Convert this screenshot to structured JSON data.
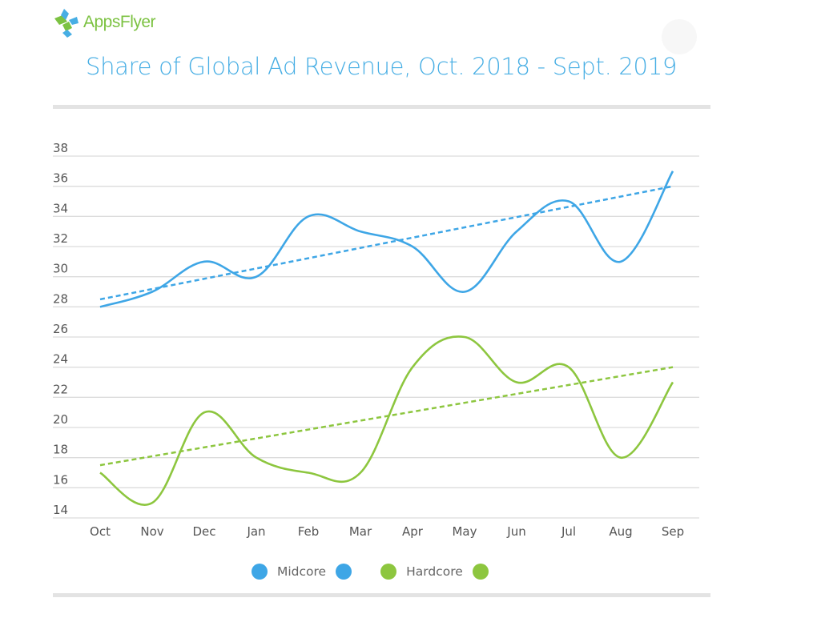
{
  "brand": {
    "name": "AppsFlyer",
    "logo_colors": [
      "#7cc242",
      "#47aee4"
    ]
  },
  "chart_data": {
    "type": "line",
    "title": "Share of Global Ad Revenue, Oct. 2018 - Sept. 2019",
    "xlabel": "",
    "ylabel": "",
    "categories": [
      "Oct",
      "Nov",
      "Dec",
      "Jan",
      "Feb",
      "Mar",
      "Apr",
      "May",
      "Jun",
      "Jul",
      "Aug",
      "Sep"
    ],
    "yticks": [
      14,
      16,
      18,
      20,
      22,
      24,
      26,
      28,
      30,
      32,
      34,
      36,
      38
    ],
    "ylim": [
      14,
      38
    ],
    "grid": true,
    "legend_position": "bottom-center",
    "series": [
      {
        "name": "Midcore",
        "color": "#3ea6e6",
        "smooth": true,
        "values": [
          28,
          29,
          31,
          30,
          34,
          33,
          32,
          29,
          33,
          35,
          31,
          37
        ],
        "trendline": {
          "style": "dashed",
          "start": 28.5,
          "end": 36
        }
      },
      {
        "name": "Hardcore",
        "color": "#8dc63f",
        "smooth": true,
        "values": [
          17,
          15,
          21,
          18,
          17,
          17,
          24,
          26,
          23,
          24,
          18,
          23
        ],
        "trendline": {
          "style": "dashed",
          "start": 17.5,
          "end": 24
        }
      }
    ]
  }
}
